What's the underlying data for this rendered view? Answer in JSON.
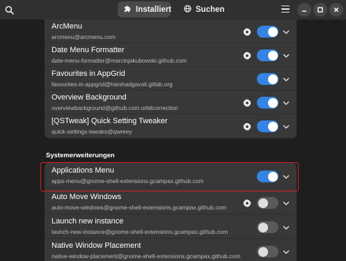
{
  "header": {
    "tabs": [
      {
        "label": "Installiert",
        "icon": "puzzle-icon",
        "active": true
      },
      {
        "label": "Suchen",
        "icon": "globe-icon",
        "active": false
      }
    ]
  },
  "colors": {
    "accent": "#3584e4",
    "highlight": "#d42424",
    "card": "#383838",
    "background": "#1e1e1e"
  },
  "user_extensions": [
    {
      "title": "ArcMenu",
      "subtitle": "arcmenu@arcmenu.com",
      "has_settings": true,
      "enabled": true
    },
    {
      "title": "Date Menu Formatter",
      "subtitle": "date-menu-formatter@marcinjakubowski.github.com",
      "has_settings": true,
      "enabled": true
    },
    {
      "title": "Favourites in AppGrid",
      "subtitle": "favourites-in-appgrid@harshadgavali.gitlab.org",
      "has_settings": false,
      "enabled": true
    },
    {
      "title": "Overview Background",
      "subtitle": "overviewbackground@github.com.orbitcorrection",
      "has_settings": true,
      "enabled": true
    },
    {
      "title": "[QSTweak] Quick Setting Tweaker",
      "subtitle": "quick-settings-tweaks@qwreey",
      "has_settings": true,
      "enabled": true
    }
  ],
  "system_section": {
    "title": "Systemerweiterungen"
  },
  "system_extensions": [
    {
      "title": "Applications Menu",
      "subtitle": "apps-menu@gnome-shell-extensions.gcampax.github.com",
      "has_settings": false,
      "enabled": true
    },
    {
      "title": "Auto Move Windows",
      "subtitle": "auto-move-windows@gnome-shell-extensions.gcampax.github.com",
      "has_settings": true,
      "enabled": false
    },
    {
      "title": "Launch new instance",
      "subtitle": "launch-new-instance@gnome-shell-extensions.gcampax.github.com",
      "has_settings": false,
      "enabled": false
    },
    {
      "title": "Native Window Placement",
      "subtitle": "native-window-placement@gnome-shell-extensions.gcampax.github.com",
      "has_settings": false,
      "enabled": false
    }
  ]
}
